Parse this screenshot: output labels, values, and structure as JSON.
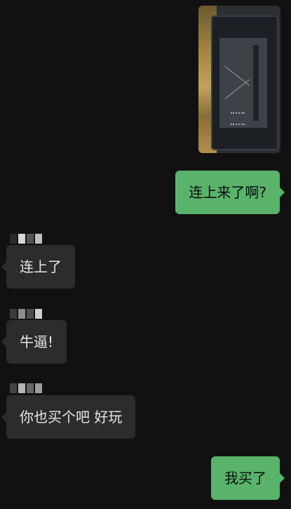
{
  "messages": [
    {
      "from": "me",
      "type": "image",
      "description": "photo"
    },
    {
      "from": "me",
      "text": "连上来了啊?"
    },
    {
      "from": "them",
      "text": "连上了"
    },
    {
      "from": "them",
      "text": "牛逼!"
    },
    {
      "from": "them",
      "text": "你也买个吧 好玩"
    },
    {
      "from": "me",
      "text": "我买了"
    }
  ],
  "colors": {
    "background": "#111111",
    "outgoing_bubble": "#59b36a",
    "incoming_bubble": "#2c2c2c",
    "incoming_text": "#e8e8e8"
  }
}
